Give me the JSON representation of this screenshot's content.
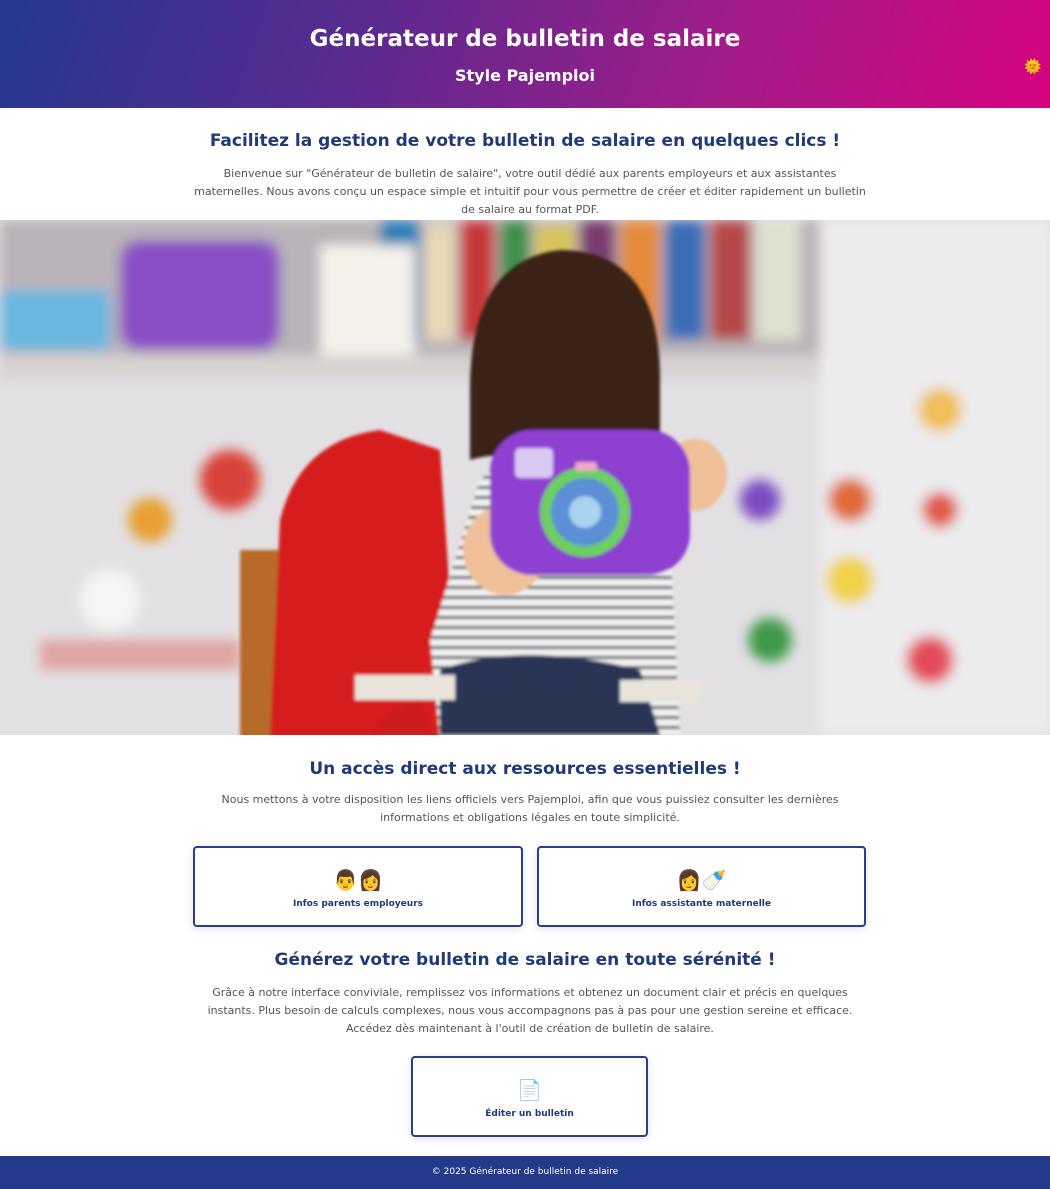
{
  "header": {
    "title": "Générateur de bulletin de salaire",
    "subtitle": "Style Pajemploi",
    "theme_toggle_icon": "sun-icon"
  },
  "intro": {
    "title": "Facilitez la gestion de votre bulletin de salaire en quelques clics !",
    "text": "Bienvenue sur \"Générateur de bulletin de salaire\", votre outil dédié aux parents employeurs et aux assistantes maternelles. Nous avons conçu un espace simple et intuitif pour vous permettre de créer et éditer rapidement un bulletin de salaire au format PDF."
  },
  "hero": {
    "image": "child-with-toy-camera-photo"
  },
  "resources": {
    "title": "Un accès direct aux ressources essentielles !",
    "text": "Nous mettons à votre disposition les liens officiels vers Pajemploi, afin que vous puissiez consulter les dernières informations et obligations légales en toute simplicité.",
    "cards": [
      {
        "icon": "parents-icon",
        "emoji": "👨👩",
        "label": "Infos parents employeurs"
      },
      {
        "icon": "nanny-with-bottle-icon",
        "emoji": "👩🍼",
        "label": "Infos assistante maternelle"
      }
    ]
  },
  "generate": {
    "title": "Générez votre bulletin de salaire en toute sérénité !",
    "text": "Grâce à notre interface conviviale, remplissez vos informations et obtenez un document clair et précis en quelques instants. Plus besoin de calculs complexes, nous vous accompagnons pas à pas pour une gestion sereine et efficace. Accédez dès maintenant à l'outil de création de bulletin de salaire.",
    "card": {
      "icon": "document-icon",
      "emoji": "📄",
      "label": "Éditer un bulletin"
    }
  },
  "footer": {
    "text": "© 2025 Générateur de bulletin de salaire"
  },
  "colors": {
    "header_gradient_start": "#23388f",
    "header_gradient_end": "#d6037f",
    "title_blue": "#1f3a7a",
    "footer_bg": "#233a8a"
  }
}
